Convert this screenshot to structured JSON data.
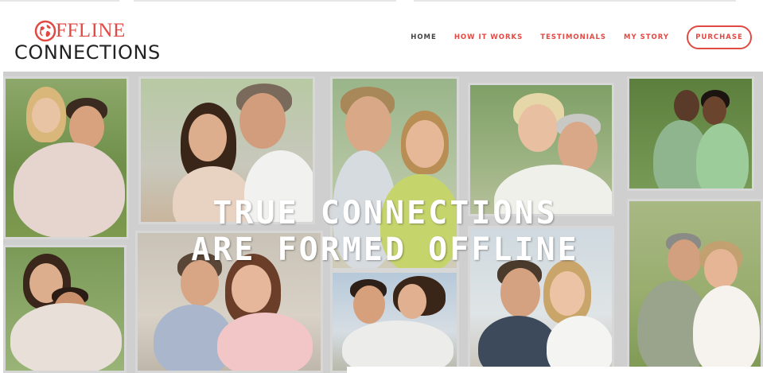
{
  "brand": {
    "logo_line1": "FFLINE",
    "logo_line2": "CONNECTIONS",
    "accent_color": "#e04a43"
  },
  "nav": {
    "items": [
      {
        "label": "HOME",
        "active": true
      },
      {
        "label": "HOW IT WORKS",
        "active": false
      },
      {
        "label": "TESTIMONIALS",
        "active": false
      },
      {
        "label": "MY STORY",
        "active": false
      }
    ],
    "purchase_label": "PURCHASE"
  },
  "hero": {
    "headline_line1": "TRUE CONNECTIONS",
    "headline_line2": "ARE FORMED OFFLINE"
  }
}
